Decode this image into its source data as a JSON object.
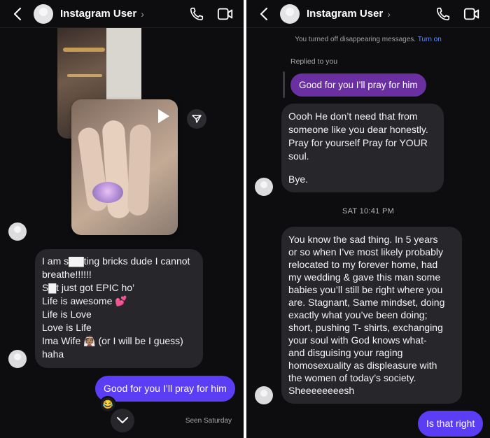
{
  "left": {
    "header": {
      "name": "Instagram User",
      "chevron": "›"
    },
    "received_message": {
      "lines": [
        "I am s▇▇ting bricks dude I cannot",
        "breathe!!!!!!",
        "S▇t just got EPIC ho’",
        "Life is awesome 💕",
        "Life is Love",
        "Love is Life",
        "Ima Wife 👰🏽 (or I will be I guess)",
        "haha"
      ]
    },
    "sent_message": "Good for you I’ll pray for him",
    "reaction_emoji": "😂",
    "seen_text": "Seen Saturday"
  },
  "right": {
    "header": {
      "name": "Instagram User",
      "chevron": "›"
    },
    "system_note": {
      "text": "You turned off disappearing messages.",
      "link": "Turn on"
    },
    "replied_label": "Replied to you",
    "replied_quote": "Good for you I’ll pray for him",
    "msg1": {
      "lines": [
        "Oooh He don’t need that from",
        "someone like you dear honestly.",
        "Pray for yourself Pray for YOUR",
        "soul."
      ],
      "tail": "Bye."
    },
    "timestamp": "SAT 10:41 PM",
    "msg2": {
      "lines": [
        "You know the sad thing. In 5 years",
        "or so when I’ve most likely probably",
        "relocated to my forever home, had",
        "my wedding & gave this man some",
        "babies you’ll still be right where you",
        "are. Stagnant, Same mindset, doing",
        "exactly what you’ve been doing;",
        "short, pushing T- shirts, exchanging",
        "your soul with God knows what-",
        "and disguising your raging",
        "homosexuality as displeasure with",
        "the women of today’s society.",
        "Sheeeeeeeesh"
      ]
    },
    "sent_message": "Is that right"
  },
  "icons": {
    "back": "chevron-left-icon",
    "call": "phone-icon",
    "video": "video-camera-icon",
    "share": "send-icon",
    "play": "play-icon",
    "scroll": "chevron-down-icon"
  },
  "colors": {
    "background": "#0d0d0f",
    "incoming_bubble": "#26262b",
    "outgoing_bubble": "#5b3df5",
    "reply_bubble": "#6a2fa0",
    "link": "#5b8cff"
  }
}
